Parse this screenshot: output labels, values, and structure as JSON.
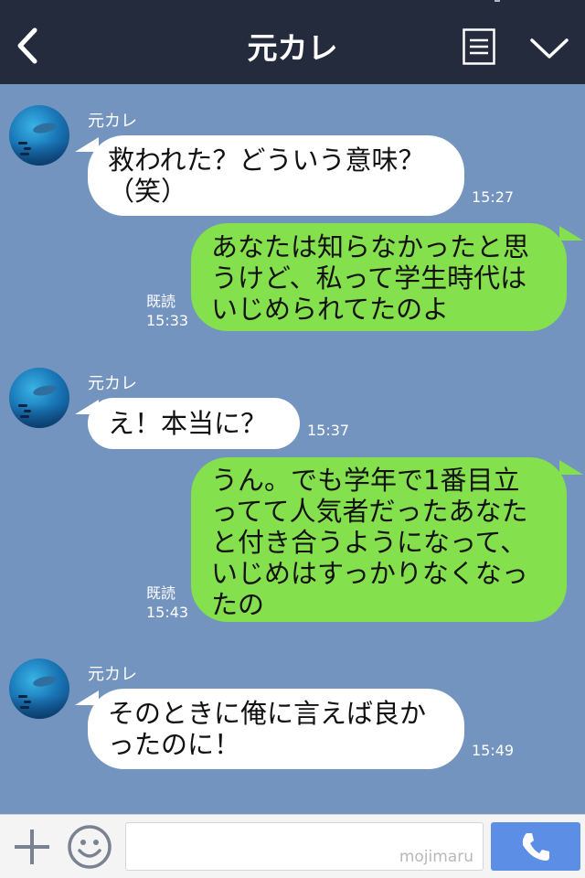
{
  "header": {
    "title": "元カレ",
    "back_icon": "chevron-left-icon",
    "menu_icon": "menu-icon",
    "collapse_icon": "chevron-down-icon",
    "background": "#232b3d"
  },
  "messages": [
    {
      "side": "in",
      "sender": "元カレ",
      "text": "救われた？どういう意味？\n（笑）",
      "time": "15:27"
    },
    {
      "side": "out",
      "read": "既読",
      "text": "あなたは知らなかったと思\nうけど、私って学生時代は\nいじめられてたのよ",
      "time": "15:33"
    },
    {
      "side": "in",
      "sender": "元カレ",
      "text": "え！本当に？",
      "time": "15:37"
    },
    {
      "side": "out",
      "read": "既読",
      "text": "うん。でも学年で1番目立\nってて人気者だったあなた\nと付き合うようになって、\nいじめはすっかりなくなっ\nたの",
      "time": "15:43"
    },
    {
      "side": "in",
      "sender": "元カレ",
      "text": "そのときに俺に言えば良か\nったのに！",
      "time": "15:49"
    }
  ],
  "footer": {
    "watermark": "mojimaru",
    "plus_icon": "plus-icon",
    "sticker_icon": "smile-icon",
    "call_icon": "phone-icon"
  },
  "colors": {
    "chat_background": "#7494c0",
    "incoming_bubble": "#ffffff",
    "outgoing_bubble": "#84e04c",
    "call_button": "#5d8ee6"
  }
}
